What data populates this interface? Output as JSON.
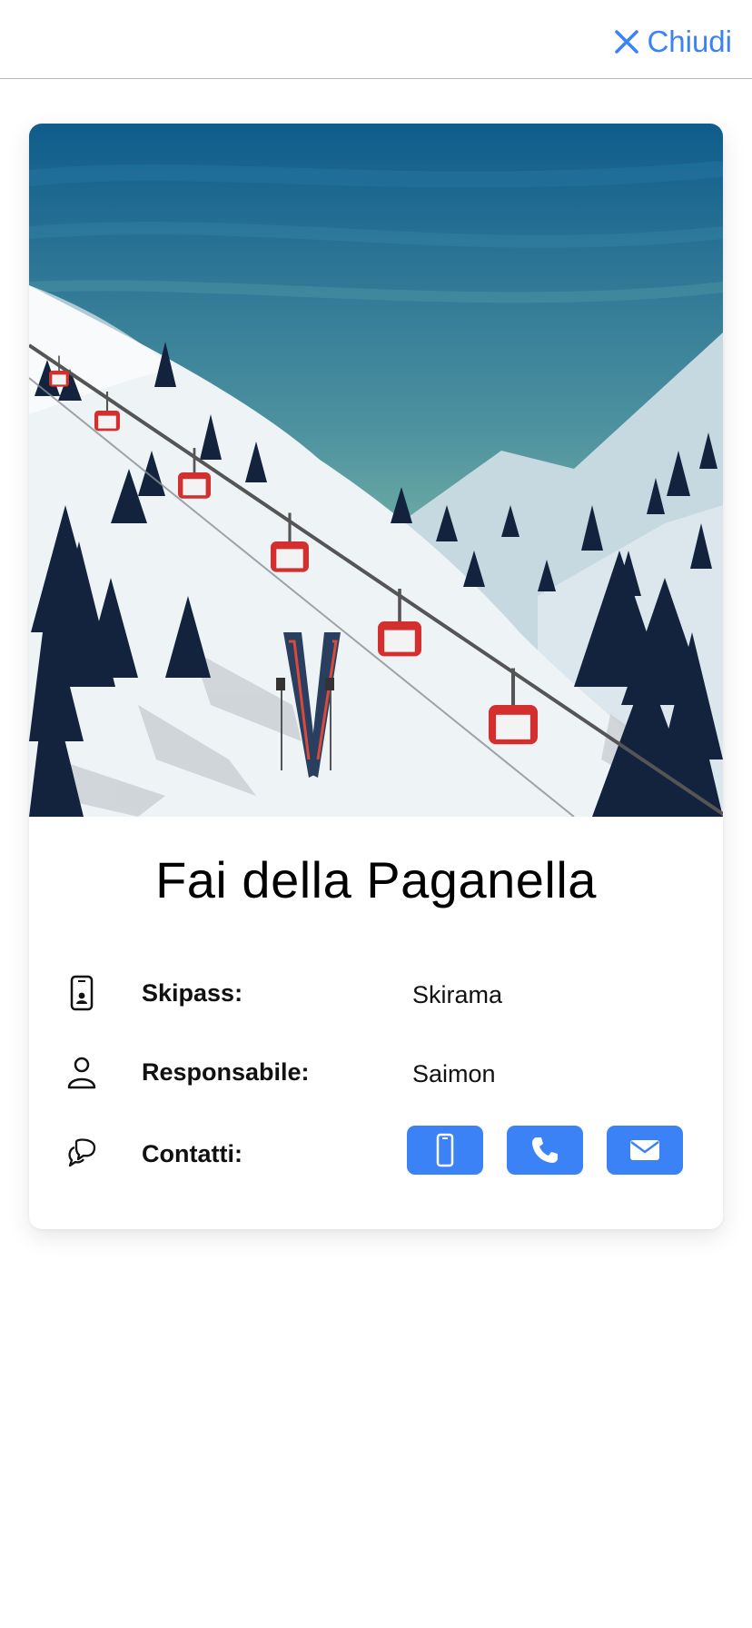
{
  "header": {
    "close_label": "Chiudi",
    "close_icon": "close-icon"
  },
  "card": {
    "title": "Fai della Paganella",
    "rows": [
      {
        "icon": "id-badge-icon",
        "label": "Skipass:",
        "value": "Skirama"
      },
      {
        "icon": "person-icon",
        "label": "Responsabile:",
        "value": "Saimon"
      },
      {
        "icon": "chat-bubbles-icon",
        "label": "Contatti:"
      }
    ],
    "contacts": [
      {
        "icon": "mobile-icon",
        "label": "Cellulare"
      },
      {
        "icon": "phone-icon",
        "label": "Telefono"
      },
      {
        "icon": "mail-icon",
        "label": "Email"
      }
    ]
  },
  "colors": {
    "accent": "#3b82f6",
    "text": "#111111",
    "divider": "#b8b8b8"
  }
}
